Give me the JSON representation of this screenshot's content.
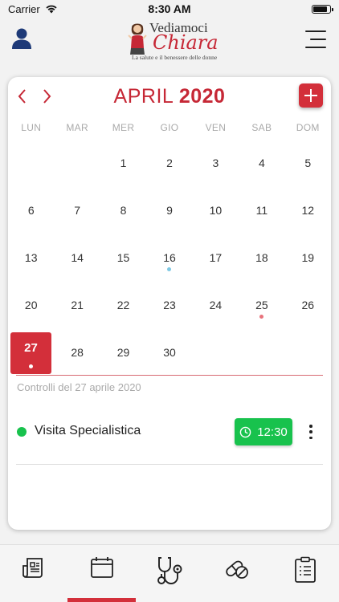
{
  "status_bar": {
    "carrier": "Carrier",
    "time": "8:30 AM",
    "battery_level": 0.85
  },
  "header": {
    "logo": {
      "line1": "Vediamoci",
      "line2": "Chiara",
      "tagline": "La salute e il benessere delle donne"
    },
    "user_icon": "user-icon",
    "menu_icon": "menu-icon"
  },
  "calendar": {
    "month": "APRIL",
    "year": "2020",
    "weekdays": [
      "LUN",
      "MAR",
      "MER",
      "GIO",
      "VEN",
      "SAB",
      "DOM"
    ],
    "days": [
      {
        "d": "1",
        "col": 2,
        "row": 0
      },
      {
        "d": "2",
        "col": 3,
        "row": 0
      },
      {
        "d": "3",
        "col": 4,
        "row": 0
      },
      {
        "d": "4",
        "col": 5,
        "row": 0
      },
      {
        "d": "5",
        "col": 6,
        "row": 0
      },
      {
        "d": "6",
        "col": 0,
        "row": 1
      },
      {
        "d": "7",
        "col": 1,
        "row": 1
      },
      {
        "d": "8",
        "col": 2,
        "row": 1
      },
      {
        "d": "9",
        "col": 3,
        "row": 1
      },
      {
        "d": "10",
        "col": 4,
        "row": 1
      },
      {
        "d": "11",
        "col": 5,
        "row": 1
      },
      {
        "d": "12",
        "col": 6,
        "row": 1
      },
      {
        "d": "13",
        "col": 0,
        "row": 2
      },
      {
        "d": "14",
        "col": 1,
        "row": 2
      },
      {
        "d": "15",
        "col": 2,
        "row": 2
      },
      {
        "d": "16",
        "col": 3,
        "row": 2,
        "dot": "#7ec8e3"
      },
      {
        "d": "17",
        "col": 4,
        "row": 2
      },
      {
        "d": "18",
        "col": 5,
        "row": 2
      },
      {
        "d": "19",
        "col": 6,
        "row": 2
      },
      {
        "d": "20",
        "col": 0,
        "row": 3
      },
      {
        "d": "21",
        "col": 1,
        "row": 3
      },
      {
        "d": "22",
        "col": 2,
        "row": 3
      },
      {
        "d": "23",
        "col": 3,
        "row": 3
      },
      {
        "d": "24",
        "col": 4,
        "row": 3
      },
      {
        "d": "25",
        "col": 5,
        "row": 3,
        "dot": "#e8737c"
      },
      {
        "d": "26",
        "col": 6,
        "row": 3
      },
      {
        "d": "27",
        "col": 0,
        "row": 4,
        "selected": true,
        "dot": "#ffffff"
      },
      {
        "d": "28",
        "col": 1,
        "row": 4
      },
      {
        "d": "29",
        "col": 2,
        "row": 4
      },
      {
        "d": "30",
        "col": 3,
        "row": 4
      }
    ],
    "controls_label": "Controlli del 27 aprile 2020",
    "appointments": [
      {
        "title": "Visita Specialistica",
        "time": "12:30",
        "status_color": "#18c24d"
      }
    ]
  },
  "tabbar": {
    "tabs": [
      {
        "icon": "news-icon"
      },
      {
        "icon": "calendar-icon",
        "active": true
      },
      {
        "icon": "stethoscope-icon"
      },
      {
        "icon": "pills-icon"
      },
      {
        "icon": "clipboard-icon"
      }
    ]
  },
  "colors": {
    "accent": "#d32f3a",
    "success": "#18c24d"
  }
}
